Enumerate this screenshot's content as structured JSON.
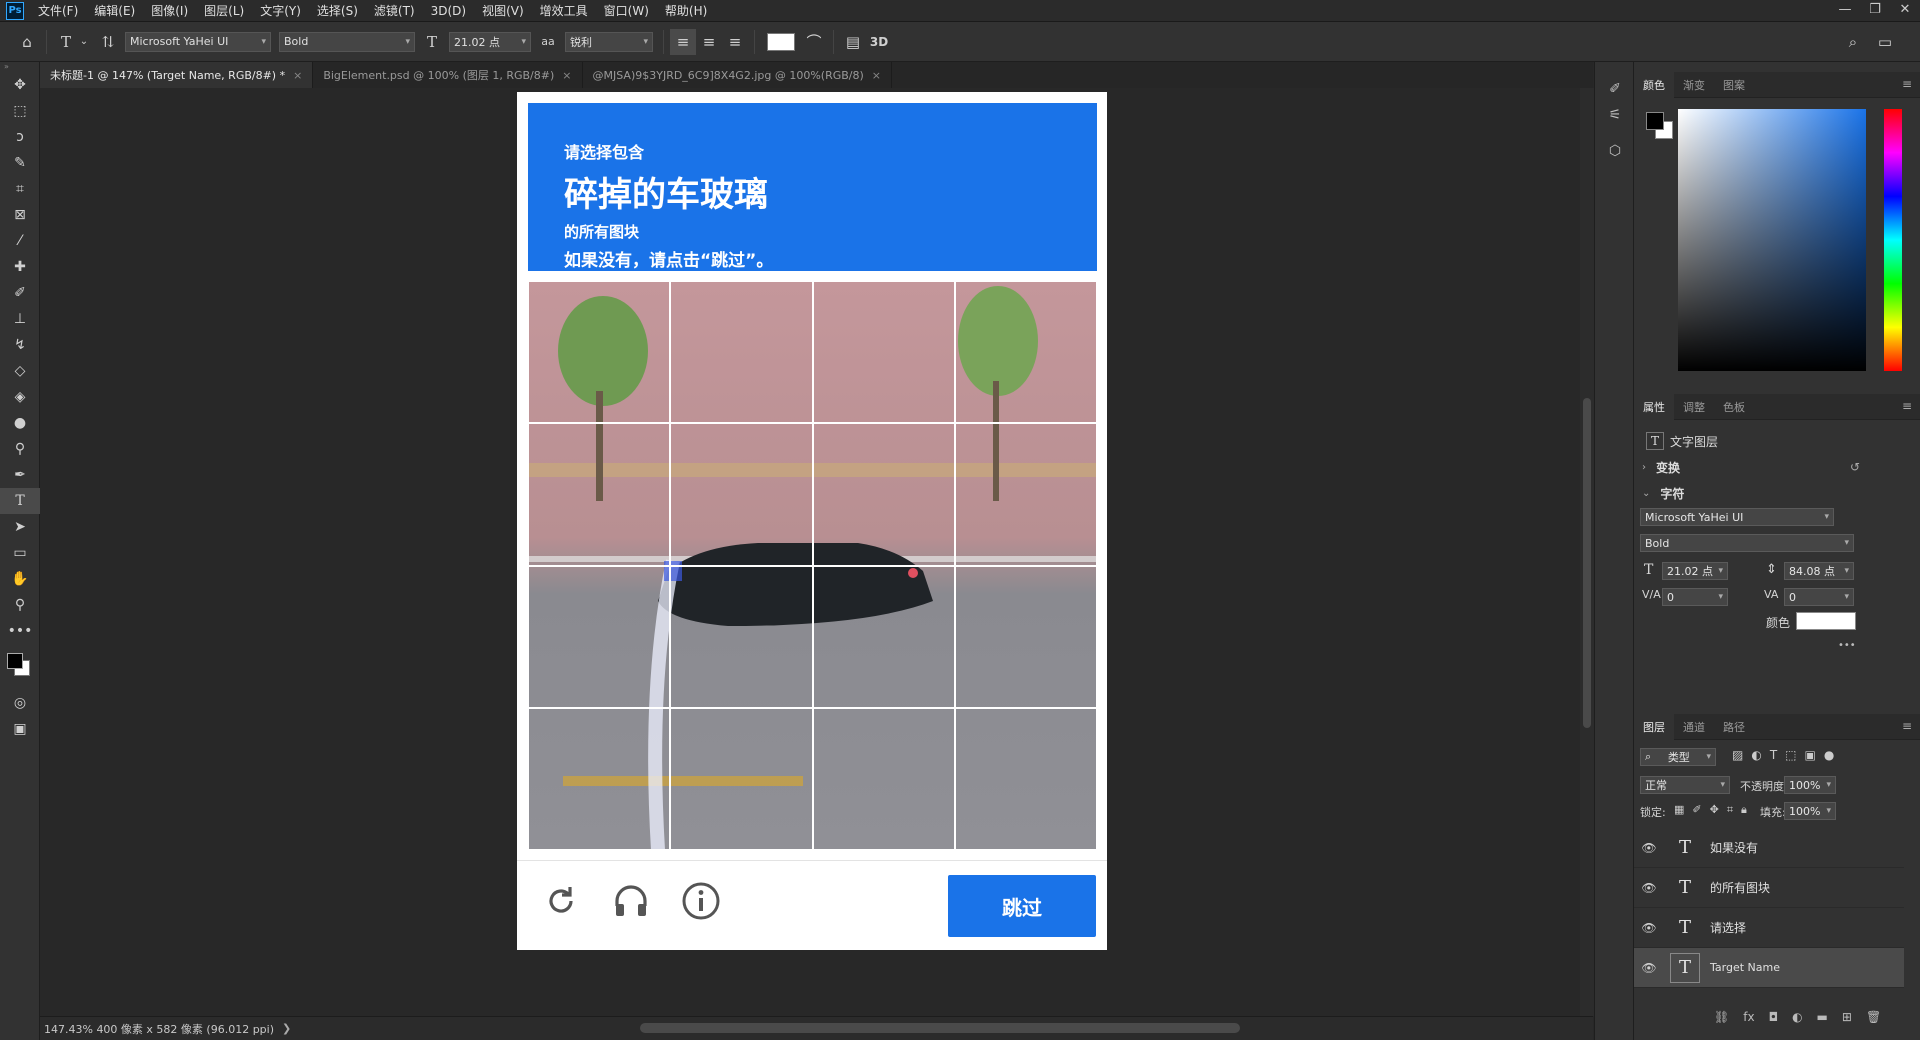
{
  "app": {
    "logo": "Ps",
    "menu": [
      "文件(F)",
      "编辑(E)",
      "图像(I)",
      "图层(L)",
      "文字(Y)",
      "选择(S)",
      "滤镜(T)",
      "3D(D)",
      "视图(V)",
      "增效工具",
      "窗口(W)",
      "帮助(H)"
    ],
    "window_controls": [
      "—",
      "❐",
      "✕"
    ]
  },
  "options": {
    "font_family": "Microsoft YaHei UI",
    "font_style": "Bold",
    "font_size": "21.02 点",
    "antialias_icon": "aa",
    "antialias": "锐利",
    "three_d": "3D"
  },
  "tabs": [
    {
      "label": "未标题-1 @ 147% (Target Name, RGB/8#) *",
      "active": true
    },
    {
      "label": "BigElement.psd @ 100% (图层 1, RGB/8#)",
      "active": false
    },
    {
      "label": "@MJSA)9$3YJRD_6C9]8X4G2.jpg @ 100%(RGB/8)",
      "active": false
    }
  ],
  "captcha": {
    "line1": "请选择包含",
    "line2": "碎掉的车玻璃",
    "line3": "的所有图块",
    "line4": "如果没有，请点击“跳过”。",
    "skip_button": "跳过",
    "icons": [
      "reload-icon",
      "headphones-icon",
      "info-icon"
    ]
  },
  "status": {
    "text": "147.43%  400 像素 x 582 像素 (96.012 ppi)",
    "arrow": "❯"
  },
  "panels": {
    "color_tabs": [
      "颜色",
      "渐变",
      "图案"
    ],
    "props_tabs": [
      "属性",
      "调整",
      "色板"
    ],
    "layer_type": "文字图层",
    "transform": "变换",
    "character": "字符",
    "font_family": "Microsoft YaHei UI",
    "font_style": "Bold",
    "font_size": "21.02 点",
    "leading": "84.08 点",
    "kerning": "0",
    "tracking": "0",
    "color_label": "颜色",
    "more": "•••",
    "layers_tabs": [
      "图层",
      "通道",
      "路径"
    ],
    "filter": "类型",
    "blend_mode": "正常",
    "opacity_label": "不透明度:",
    "opacity": "100%",
    "lock_label": "锁定:",
    "fill_label": "填充:",
    "fill": "100%",
    "layers": [
      {
        "name": "如果没有",
        "active": false
      },
      {
        "name": "的所有图块",
        "active": false
      },
      {
        "name": "请选择",
        "active": false
      },
      {
        "name": "Target Name",
        "active": true
      }
    ]
  },
  "colors": {
    "accent_blue": "#1a73e8",
    "ui_dark": "#323232"
  }
}
